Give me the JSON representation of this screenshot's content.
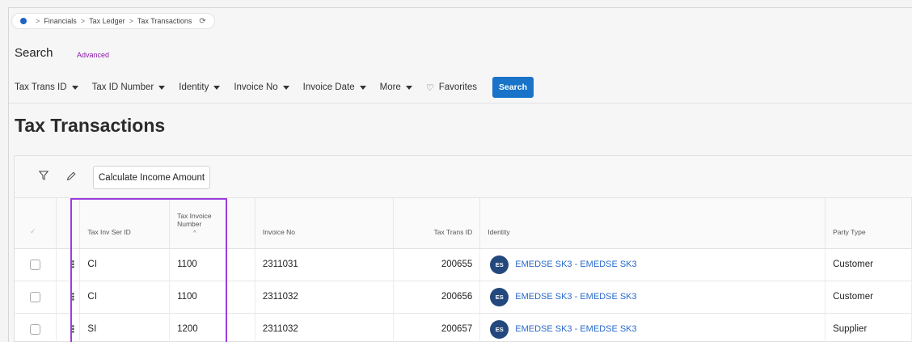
{
  "breadcrumb": {
    "items": [
      "Financials",
      "Tax Ledger",
      "Tax Transactions"
    ],
    "separator": ">",
    "refresh_glyph": "⟳",
    "home_color": "#1f63c6"
  },
  "search": {
    "title": "Search",
    "advanced": "Advanced",
    "filters": [
      "Tax Trans ID",
      "Tax ID Number",
      "Identity",
      "Invoice No",
      "Invoice Date",
      "More"
    ],
    "favorites": "Favorites",
    "button": "Search"
  },
  "page": {
    "title": "Tax Transactions"
  },
  "toolbar": {
    "filter_icon": "filter-icon",
    "edit_icon": "pencil-icon",
    "calc_button": "Calculate Income Amount"
  },
  "table": {
    "headers": {
      "tax_inv_ser_id": "Tax Inv Ser ID",
      "tax_invoice_number_1": "Tax Invoice",
      "tax_invoice_number_2": "Number",
      "sort_glyph": "^",
      "invoice_no": "Invoice No",
      "tax_trans_id": "Tax Trans ID",
      "identity": "Identity",
      "party_type": "Party Type"
    },
    "rows": [
      {
        "ser": "CI",
        "inv_num": "1100",
        "invoice_no": "2311031",
        "trans_id": "200655",
        "avatar": "ES",
        "identity": "EMEDSE SK3 - EMEDSE SK3",
        "party_type": "Customer"
      },
      {
        "ser": "CI",
        "inv_num": "1100",
        "invoice_no": "2311032",
        "trans_id": "200656",
        "avatar": "ES",
        "identity": "EMEDSE SK3 - EMEDSE SK3",
        "party_type": "Customer"
      },
      {
        "ser": "SI",
        "inv_num": "1200",
        "invoice_no": "2311032",
        "trans_id": "200657",
        "avatar": "ES",
        "identity": "EMEDSE SK3 - EMEDSE SK3",
        "party_type": "Supplier"
      }
    ]
  },
  "colors": {
    "accent": "#1873c9",
    "highlight": "#9b3de0",
    "advanced": "#8a1aa8",
    "avatar": "#23487d",
    "link": "#2a6ac9"
  }
}
